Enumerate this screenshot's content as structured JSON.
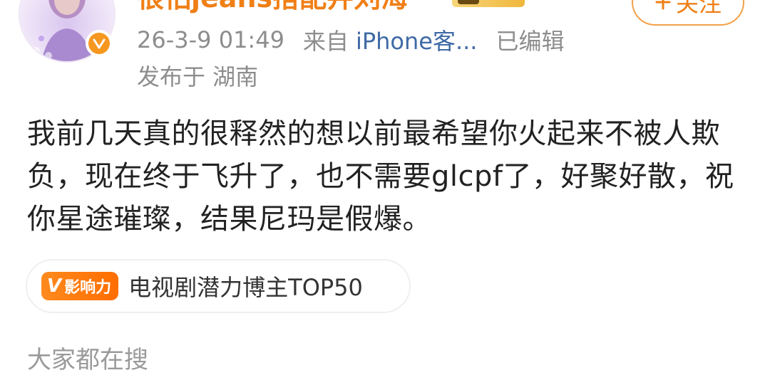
{
  "header": {
    "username": "很怕jeans搭配井刘海",
    "follow_label": "关注",
    "follow_icon": "plus-icon"
  },
  "meta": {
    "timestamp": "26-3-9 01:49",
    "source_prefix": "来自",
    "source": "iPhone客...",
    "edited": "已编辑",
    "location_label": "发布于 湖南"
  },
  "post": {
    "text": "我前几天真的很释然的想以前最希望你火起来不被人欺负，现在终于飞升了，也不需要glcpf了，好聚好散，祝你星途璀璨，结果尼玛是假爆。"
  },
  "influence": {
    "badge_v": "V",
    "badge_label": "影响力",
    "title": "电视剧潜力博主TOP50"
  },
  "section": {
    "label": "大家都在搜"
  },
  "colors": {
    "accent": "#f07f16",
    "link": "#3f6aa5",
    "meta": "#8d8d8d",
    "text": "#222222"
  }
}
